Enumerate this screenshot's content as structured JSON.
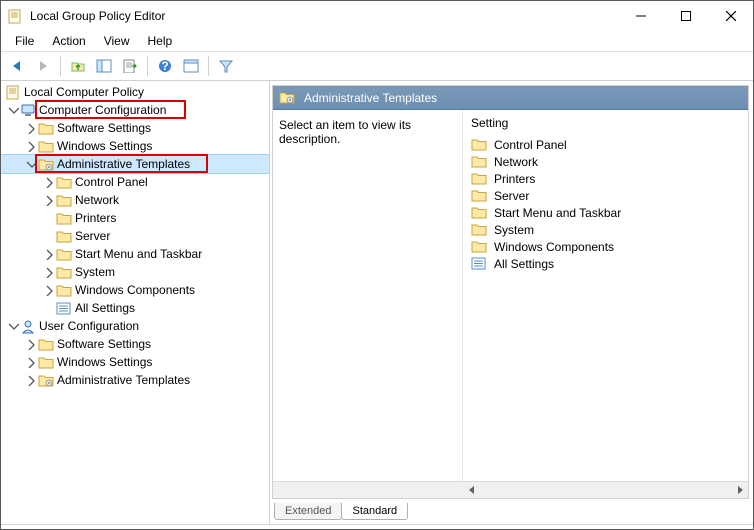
{
  "window": {
    "title": "Local Group Policy Editor"
  },
  "menu": {
    "file": "File",
    "action": "Action",
    "view": "View",
    "help": "Help"
  },
  "tree": {
    "root": "Local Computer Policy",
    "cc": "Computer Configuration",
    "cc_ss": "Software Settings",
    "cc_ws": "Windows Settings",
    "cc_at": "Administrative Templates",
    "cc_at_cp": "Control Panel",
    "cc_at_net": "Network",
    "cc_at_prn": "Printers",
    "cc_at_srv": "Server",
    "cc_at_smt": "Start Menu and Taskbar",
    "cc_at_sys": "System",
    "cc_at_wc": "Windows Components",
    "cc_at_all": "All Settings",
    "uc": "User Configuration",
    "uc_ss": "Software Settings",
    "uc_ws": "Windows Settings",
    "uc_at": "Administrative Templates"
  },
  "right": {
    "header": "Administrative Templates",
    "desc": "Select an item to view its description.",
    "setting_label": "Setting",
    "items": {
      "cp": "Control Panel",
      "net": "Network",
      "prn": "Printers",
      "srv": "Server",
      "smt": "Start Menu and Taskbar",
      "sys": "System",
      "wc": "Windows Components",
      "all": "All Settings"
    }
  },
  "tabs": {
    "extended": "Extended",
    "standard": "Standard"
  }
}
